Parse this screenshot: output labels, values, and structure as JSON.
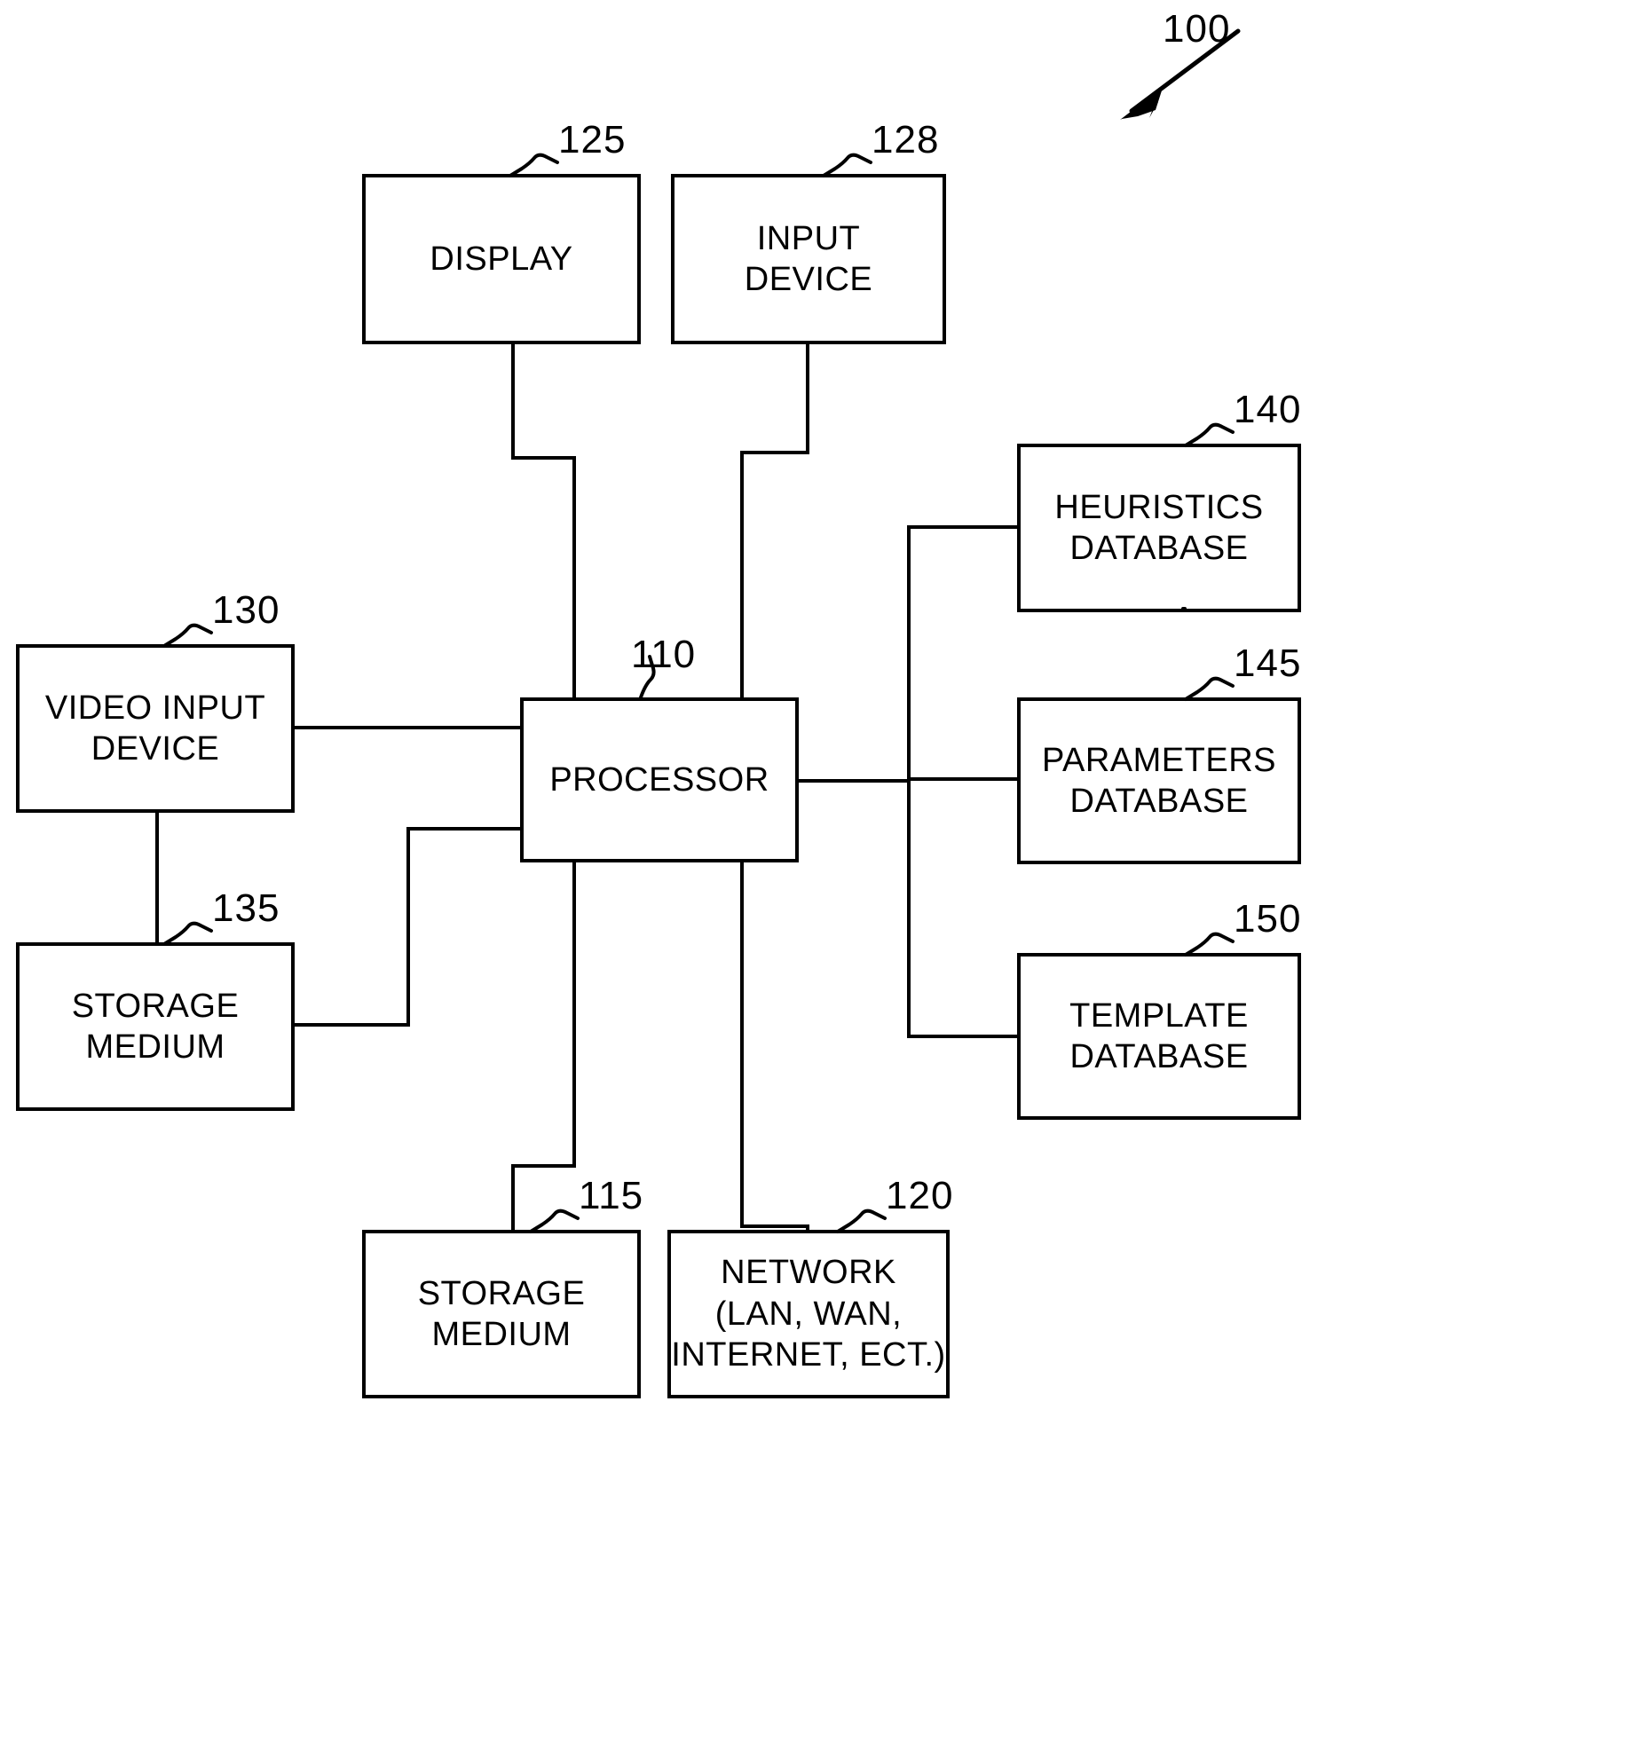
{
  "figure": {
    "system_reference": "100",
    "title": ""
  },
  "blocks": [
    {
      "id": "display",
      "label": "DISPLAY",
      "ref": "125"
    },
    {
      "id": "input_device",
      "label": "INPUT\nDEVICE",
      "ref": "128"
    },
    {
      "id": "processor",
      "label": "PROCESSOR",
      "ref": "110"
    },
    {
      "id": "video_input",
      "label": "VIDEO  INPUT\nDEVICE",
      "ref": "130"
    },
    {
      "id": "storage_left",
      "label": "STORAGE\nMEDIUM",
      "ref": "135"
    },
    {
      "id": "storage_bottom",
      "label": "STORAGE\nMEDIUM",
      "ref": "115"
    },
    {
      "id": "network",
      "label": "NETWORK\n(LAN,  WAN,\nINTERNET,  ECT.)",
      "ref": "120"
    },
    {
      "id": "heuristics_db",
      "label": "HEURISTICS\nDATABASE",
      "ref": "140"
    },
    {
      "id": "parameters_db",
      "label": "PARAMETERS\nDATABASE",
      "ref": "145"
    },
    {
      "id": "template_db",
      "label": "TEMPLATE\nDATABASE",
      "ref": "150"
    }
  ],
  "colors": {
    "line": "#000000",
    "background": "#ffffff",
    "text": "#000000"
  }
}
